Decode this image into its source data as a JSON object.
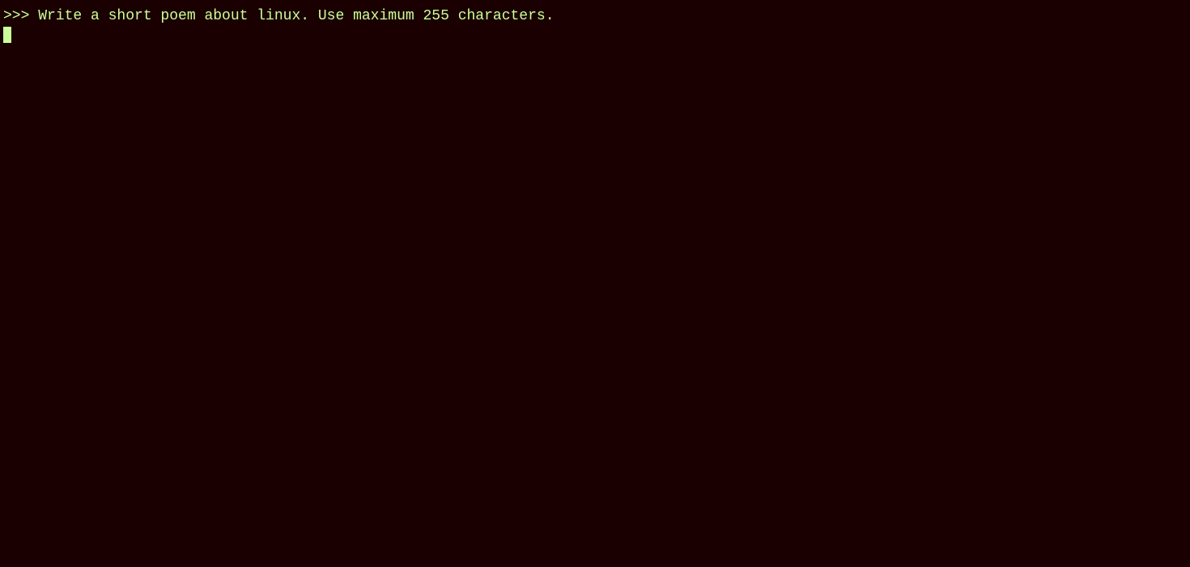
{
  "terminal": {
    "background_color": "#1a0000",
    "text_color": "#ccff99",
    "prompt": ">>>",
    "command_line": " Write a short poem about linux. Use maximum 255 characters.",
    "cursor_visible": true
  }
}
